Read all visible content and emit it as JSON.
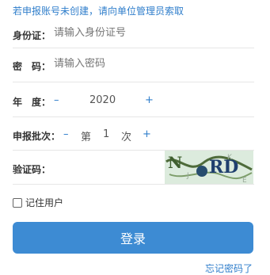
{
  "notice": "若申报账号未创建，请向单位管理员索取",
  "fields": {
    "id_label": "身份证：",
    "id_placeholder": "请输入身份证号",
    "password_label": "密　码：",
    "password_placeholder": "请输入密码",
    "year_label": "年　度：",
    "year_minus": "–",
    "year_value": "2020",
    "year_plus": "+",
    "batch_label": "申报批次：",
    "batch_minus": "–",
    "batch_prefix": "第",
    "batch_value": "1",
    "batch_suffix": "次",
    "batch_plus": "+",
    "captcha_label": "验证码："
  },
  "captcha": {
    "text": "RD",
    "noise_letters": [
      "N",
      "K",
      "J",
      "E"
    ]
  },
  "remember_label": "记住用户",
  "login_label": "登录",
  "forgot_label": "忘记密码了",
  "colors": {
    "accent": "#3d8bd3",
    "link": "#2f7ecb"
  }
}
